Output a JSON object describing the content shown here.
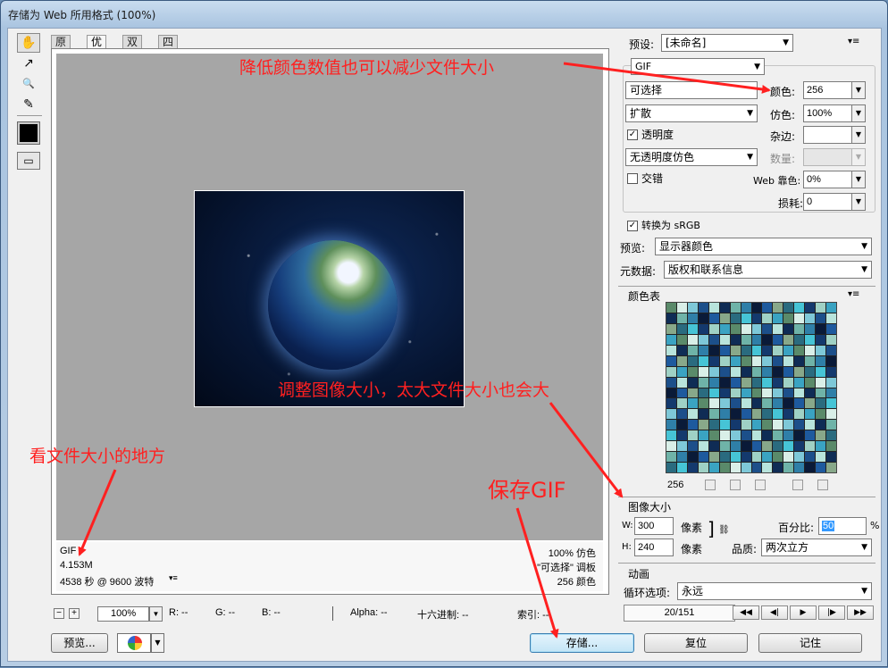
{
  "window": {
    "title": "存储为 Web 所用格式 (100%)"
  },
  "tabs": [
    {
      "label": "原稿",
      "active": false
    },
    {
      "label": "优化",
      "active": true
    },
    {
      "label": "双联",
      "active": false
    },
    {
      "label": "四联",
      "active": false
    }
  ],
  "tools": [
    {
      "name": "hand-tool",
      "glyph": "✋"
    },
    {
      "name": "slice-select-tool",
      "glyph": "↗"
    },
    {
      "name": "zoom-tool",
      "glyph": "🔍"
    },
    {
      "name": "eyedropper-tool",
      "glyph": "✎"
    }
  ],
  "info_panel": {
    "format": "GIF",
    "size": "4.153M",
    "time": "4538 秒 @ 9600 波特",
    "dither": "100% 仿色",
    "palette": "\"可选择\" 调板",
    "colors": "256 颜色"
  },
  "statusbar": {
    "zoom": "100%",
    "r": "R: --",
    "g": "G: --",
    "b": "B: --",
    "alpha": "Alpha: --",
    "hex": "十六进制: --",
    "index": "索引: --"
  },
  "buttons": {
    "preview": "预览...",
    "save": "存储...",
    "reset": "复位",
    "remember": "记住"
  },
  "right_panel": {
    "preset_label": "预设:",
    "preset_value": "[未命名]",
    "format": "GIF",
    "reduction": "可选择",
    "dither_algo": "扩散",
    "transparency_label": "透明度",
    "transparency_checked": true,
    "transparency_dither": "无透明度仿色",
    "interlaced_label": "交错",
    "interlaced_checked": false,
    "colors_label": "颜色:",
    "colors_value": "256",
    "dither_label": "仿色:",
    "dither_value": "100%",
    "matte_label": "杂边:",
    "matte_value": "",
    "amount_label": "数量:",
    "websnap_label": "Web 靠色:",
    "websnap_value": "0%",
    "lossy_label": "损耗:",
    "lossy_value": "0",
    "convert_srgb_label": "转换为 sRGB",
    "convert_srgb_checked": true,
    "preview_label": "预览:",
    "preview_value": "显示器颜色",
    "metadata_label": "元数据:",
    "metadata_value": "版权和联系信息",
    "color_table_title": "颜色表",
    "color_count": "256",
    "image_size_title": "图像大小",
    "w_label": "W:",
    "w_value": "300",
    "h_label": "H:",
    "h_value": "240",
    "px_unit": "像素",
    "percent_label": "百分比:",
    "percent_value": "50",
    "percent_unit": "%",
    "quality_label": "品质:",
    "quality_value": "两次立方",
    "animation_title": "动画",
    "loop_label": "循环选项:",
    "loop_value": "永远",
    "frame_counter": "20/151"
  },
  "annotations": {
    "colors_tip": "降低颜色数值也可以减少文件大小",
    "size_tip": "调整图像大小，太大文件大小也会大",
    "filesize_tip": "看文件大小的地方",
    "save_tip": "保存GIF"
  },
  "colors": {
    "annotation": "#ff2020",
    "canvas": "#a6a6a6",
    "palette_sample": [
      "#5a8a6a",
      "#2f7fa8",
      "#9fd1c5",
      "#0f2c55",
      "#46c4d6",
      "#1c4f8a",
      "#88a88a",
      "#d9efe8",
      "#0a1a38",
      "#3aa3c2",
      "#6fb3a8",
      "#14396d",
      "#b8e4dc",
      "#2a6b7f",
      "#7ec8d8",
      "#1e5a9e"
    ]
  }
}
